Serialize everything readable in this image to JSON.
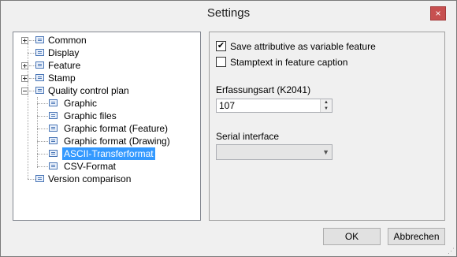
{
  "window": {
    "title": "Settings",
    "close_glyph": "×"
  },
  "tree": {
    "items": [
      {
        "label": "Common",
        "expander": "collapsed",
        "icon": "list-icon"
      },
      {
        "label": "Display",
        "expander": "none",
        "icon": "list-icon"
      },
      {
        "label": "Feature",
        "expander": "collapsed",
        "icon": "list-icon"
      },
      {
        "label": "Stamp",
        "expander": "collapsed",
        "icon": "list-icon"
      },
      {
        "label": "Quality control plan",
        "expander": "expanded",
        "icon": "list-icon"
      },
      {
        "label": "Graphic",
        "icon": "list-icon"
      },
      {
        "label": "Graphic files",
        "icon": "list-icon"
      },
      {
        "label": "Graphic format (Feature)",
        "icon": "list-icon"
      },
      {
        "label": "Graphic format (Drawing)",
        "icon": "list-icon"
      },
      {
        "label": "ASCII-Transferformat",
        "icon": "list-icon",
        "selected": true
      },
      {
        "label": "CSV-Format",
        "icon": "list-icon"
      },
      {
        "label": "Version comparison",
        "expander": "none",
        "icon": "list-icon"
      }
    ]
  },
  "panel": {
    "save_attr": {
      "label": "Save attributive as variable feature",
      "checked": true
    },
    "stamptext": {
      "label": "Stamptext in feature caption",
      "checked": false
    },
    "erfassung": {
      "label": "Erfassungsart (K2041)",
      "value": "107"
    },
    "serial": {
      "label": "Serial interface",
      "value": ""
    }
  },
  "buttons": {
    "ok": "OK",
    "cancel": "Abbrechen"
  },
  "colors": {
    "selection": "#3399ff",
    "close": "#c75050"
  }
}
